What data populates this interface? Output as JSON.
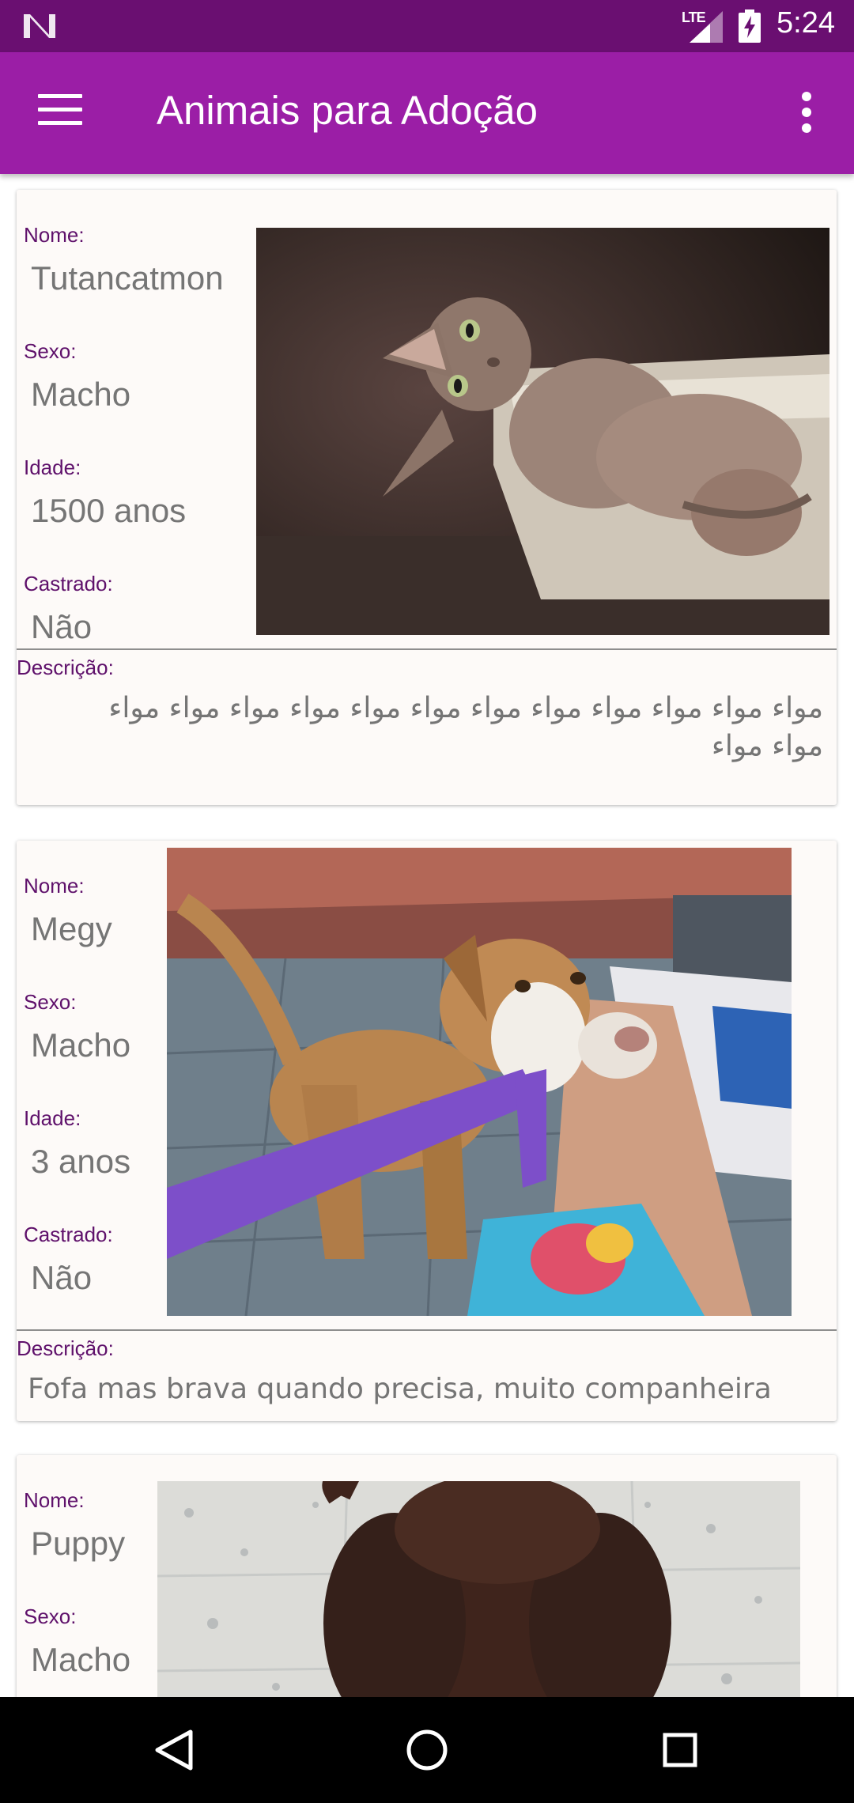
{
  "status_bar": {
    "network": "LTE",
    "time": "5:24"
  },
  "app_bar": {
    "title": "Animais para Adoção",
    "menu_icon": "hamburger-menu-icon",
    "overflow_icon": "more-vert-icon"
  },
  "labels": {
    "name": "Nome:",
    "sex": "Sexo:",
    "age": "Idade:",
    "neutered": "Castrado:",
    "description": "Descrição:"
  },
  "animals": [
    {
      "name": "Tutancatmon",
      "sex": "Macho",
      "age": "1500 anos",
      "neutered": "Não",
      "description": "مواء مواء مواء مواء مواء مواء مواء مواء مواء مواء مواء مواء مواء مواء",
      "photo": "sphynx-cat-photo"
    },
    {
      "name": "Megy",
      "sex": "Macho",
      "age": "3 anos",
      "neutered": "Não",
      "description": "Fofa mas brava quando precisa, muito companheira",
      "photo": "dog-with-purple-hose-photo"
    },
    {
      "name": "Puppy",
      "sex": "Macho",
      "photo": "brown-puppy-photo"
    }
  ],
  "nav_bar": {
    "back_icon": "back-icon",
    "home_icon": "home-icon",
    "recents_icon": "recents-icon"
  }
}
